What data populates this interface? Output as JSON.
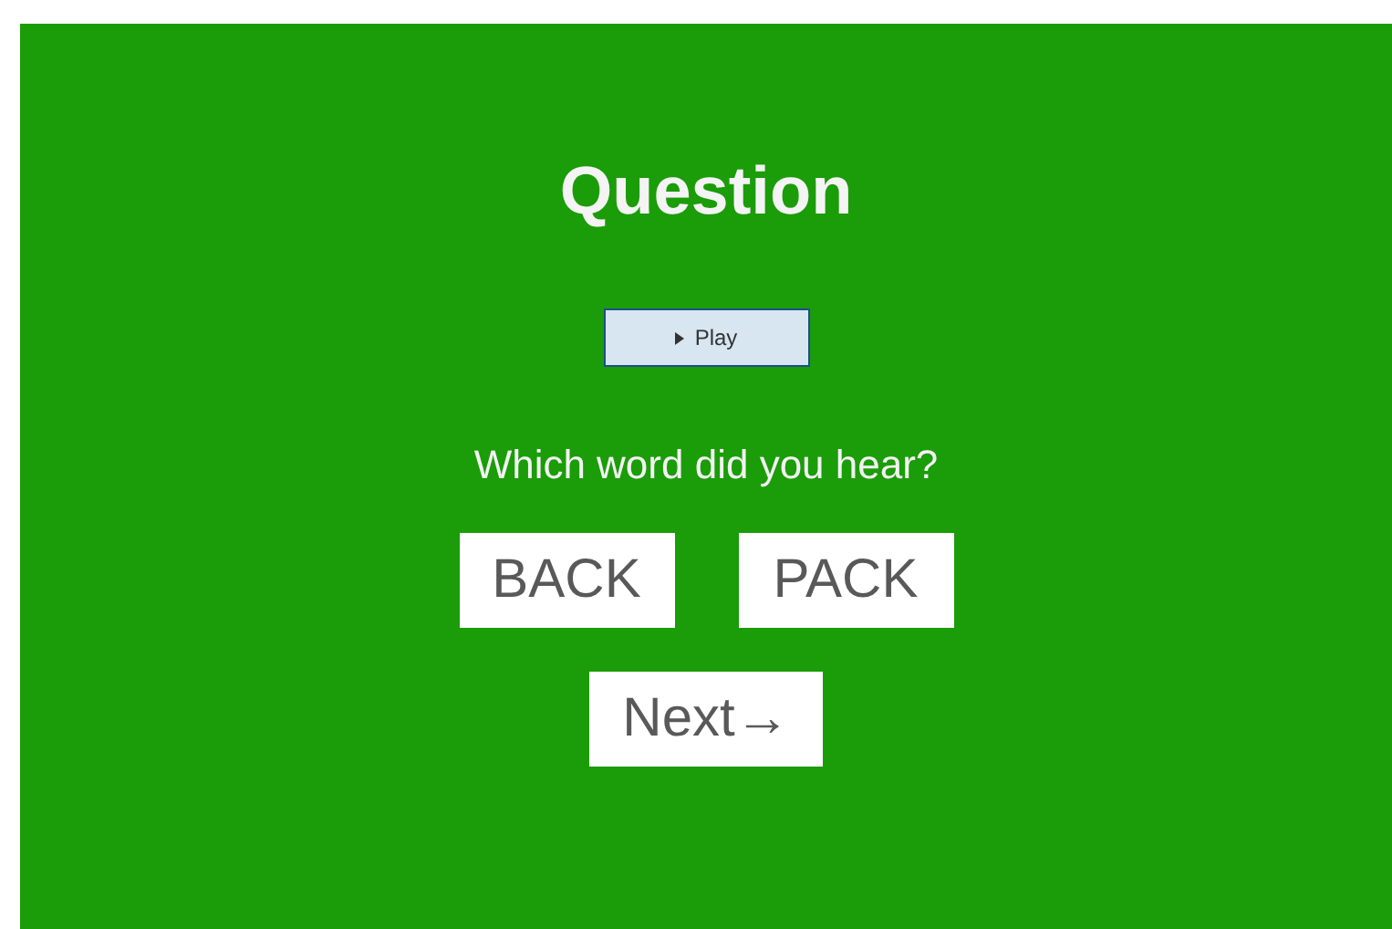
{
  "title": "Question",
  "play_button": {
    "label": "Play"
  },
  "prompt": "Which word did you hear?",
  "choices": [
    {
      "label": "BACK",
      "selected": false
    },
    {
      "label": "PACK",
      "selected": false
    }
  ],
  "next_button": {
    "label": "Next→"
  }
}
